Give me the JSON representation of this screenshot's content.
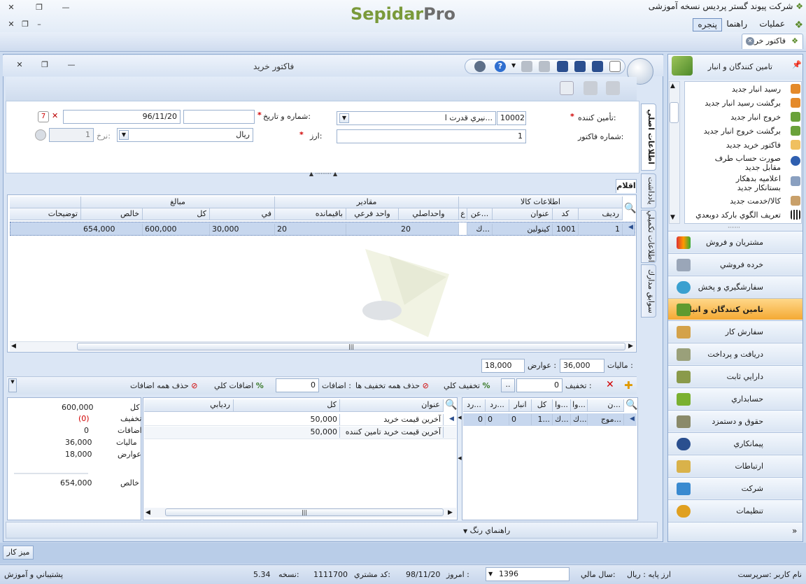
{
  "app": {
    "company_title": "شرکت پیوند گستر پردیس نسخه آموزشی",
    "logo_a": "Sepidar",
    "logo_b": "Pro"
  },
  "menu": [
    "عملیات",
    "راهنما",
    "پنجره"
  ],
  "doc_tab": "فاکتور خرید",
  "window": {
    "title": "فاکتور خرید"
  },
  "side_tabs": [
    "اطلاعات اصلي",
    "يادداشت",
    "اطلاعات تكميلي",
    "سوابق مدارك"
  ],
  "form": {
    "supplier_label": "تأمین کننده:",
    "supplier_code": "10002",
    "supplier_name": "نيري قدرت ا...",
    "number_date_label": "شماره و تاریخ:",
    "number_value": "",
    "date_value": "96/11/20",
    "invoice_no_label": "شماره فاکتور:",
    "invoice_no": "1",
    "currency_label": "ارز:",
    "currency": "ريال",
    "rate_label": "نرخ:",
    "rate": "1"
  },
  "items_tab": "اقلام",
  "grid": {
    "groups": [
      "اطلاعات كالا",
      "مقادير",
      "مبالغ"
    ],
    "columns": [
      "رديف",
      "كد",
      "عنوان",
      "عن...",
      "ع",
      "واحداصلي",
      "واحد فرعي",
      "باقيمانده",
      "في",
      "كل",
      "خالص",
      "توضيحات"
    ],
    "row": {
      "row": "1",
      "code": "1001",
      "title": "كينولين",
      "short": "ك...",
      "qty": "20",
      "remain": "20",
      "fee": "30,000",
      "total": "600,000",
      "net": "654,000"
    }
  },
  "totals": {
    "tax_label": "ماليات :",
    "tax": "36,000",
    "duty_label": "عوارض :",
    "duty": "18,000"
  },
  "discount_bar": {
    "discount_label": "تخفيف :",
    "discount": "0",
    "total_discount": "تخفيف كلي",
    "remove_discounts": "حذف همه تخفيف ها",
    "additions_label": "اضافات :",
    "additions": "0",
    "total_additions": "اضافات كلي",
    "remove_additions": "حذف همه اضافات"
  },
  "left_grid": {
    "cols": [
      "ن...",
      "وا...",
      "وا...",
      "كل",
      "انبار",
      "رد...",
      "رد..."
    ],
    "row": [
      "موج...",
      "ك...",
      "ك...",
      "1...",
      "0",
      "0",
      "0"
    ]
  },
  "mid_grid": {
    "cols": [
      "عنوان",
      "كل",
      "رديابي"
    ],
    "rows": [
      [
        "آخرين قيمت خريد",
        "50,000"
      ],
      [
        "آخرين قيمت خريد تامين كننده",
        "50,000"
      ]
    ]
  },
  "summary": [
    {
      "label": "كل",
      "value": "600,000"
    },
    {
      "label": "تخفيف",
      "value": "(0)"
    },
    {
      "label": "اضافات",
      "value": "0"
    },
    {
      "label": "ماليات",
      "value": "36,000"
    },
    {
      "label": "عوارض",
      "value": "18,000"
    },
    {
      "label": "خالص",
      "value": "654,000"
    }
  ],
  "color_guide": "راهنماي رنگ",
  "right_panel": {
    "title": "تامین کنندگان و انبار",
    "tasks": [
      "رسید انبار جدید",
      "برگشت رسید انبار جدید",
      "خروج انبار جدید",
      "برگشت خروج انبار جدید",
      "فاکتور خرید جدید",
      "صورت حساب طرف مقابل جدید",
      "اعلامیه بدهکار بستانکار جدید",
      "کالا/خدمت جدید",
      "تعريف الگوي بارکد دوبعدي"
    ],
    "modules": [
      "مشتريان و فروش",
      "خرده فروشي",
      "سفارشگيري و پخش",
      "تامين كنندگان و انبار",
      "سفارش كار",
      "دريافت و پرداخت",
      "دارايي ثابت",
      "حسابداري",
      "حقوق و دستمزد",
      "پيمانكاري",
      "ارتباطات",
      "شركت",
      "تنظيمات"
    ]
  },
  "desk_button": "ميز كار",
  "status": {
    "user": "نام كاربر :سرپرست",
    "base_currency": "ارز پايه :   ريال",
    "fiscal_year_label": "سال مالي:",
    "fiscal_year": "1396",
    "today_label": "امروز :",
    "today": "98/11/20",
    "customer_code_label": "كد مشتري:",
    "customer_code": "1111700",
    "version_label": "نسخه:",
    "version": "5.34",
    "support": "پشتيباني و آموزش"
  },
  "colors": {
    "accent": "#f4a933",
    "required": "#d00000",
    "brand_green": "#7a9a3a"
  }
}
